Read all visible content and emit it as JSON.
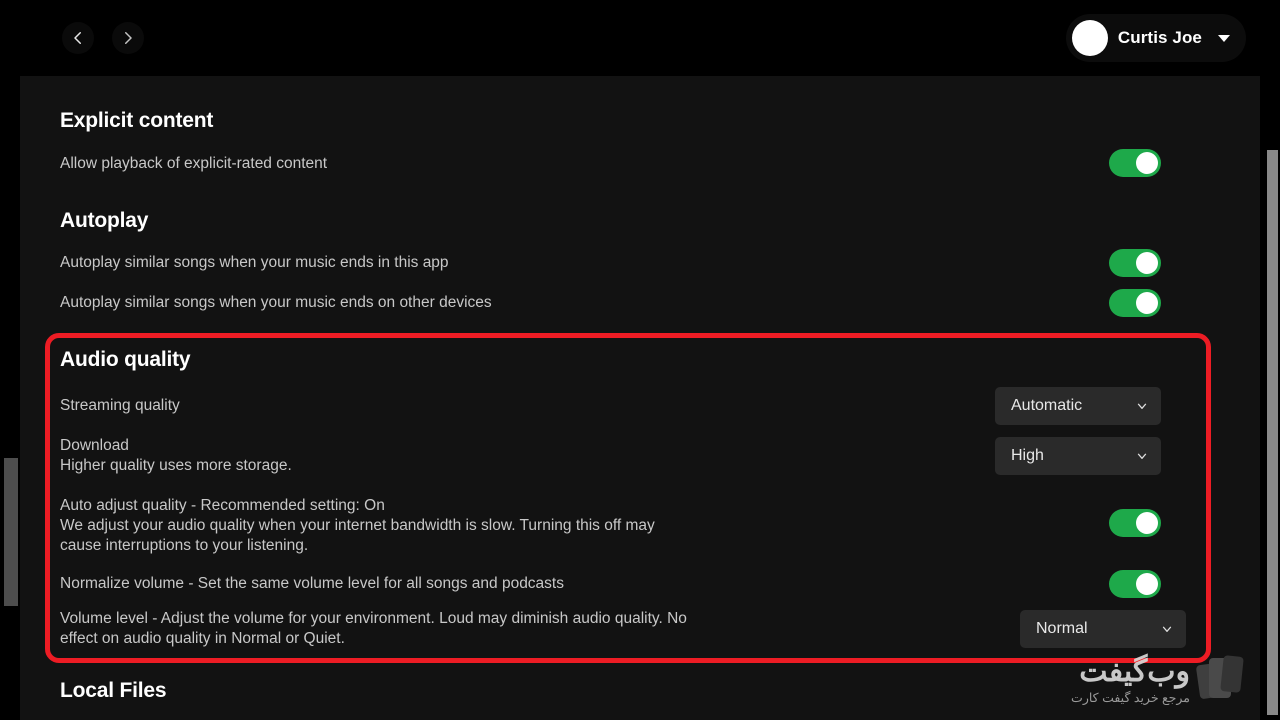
{
  "header": {
    "back_icon": "chevron-left-icon",
    "forward_icon": "chevron-right-icon",
    "user_name": "Curtis Joe",
    "user_caret_icon": "chevron-down-icon",
    "avatar_icon": "avatar"
  },
  "sections": {
    "explicit": {
      "title": "Explicit content",
      "row_label": "Allow playback of explicit-rated content",
      "toggle_state": "on"
    },
    "autoplay": {
      "title": "Autoplay",
      "row1_label": "Autoplay similar songs when your music ends in this app",
      "row1_toggle_state": "on",
      "row2_label": "Autoplay similar songs when your music ends on other devices",
      "row2_toggle_state": "on"
    },
    "audio_quality": {
      "title": "Audio quality",
      "streaming_label": "Streaming quality",
      "streaming_value": "Automatic",
      "download_label": "Download",
      "download_sub": "Higher quality uses more storage.",
      "download_value": "High",
      "auto_adjust_label": "Auto adjust quality - Recommended setting: On",
      "auto_adjust_sub_line1": "We adjust your audio quality when your internet bandwidth is slow. Turning this off may",
      "auto_adjust_sub_line2": "cause interruptions to your listening.",
      "auto_adjust_toggle_state": "on",
      "normalize_label": "Normalize volume - Set the same volume level for all songs and podcasts",
      "normalize_toggle_state": "on",
      "volume_level_line1": "Volume level - Adjust the volume for your environment. Loud may diminish audio quality. No",
      "volume_level_line2": "effect on audio quality in Normal or Quiet.",
      "volume_level_value": "Normal",
      "highlight_color": "#ed1c24"
    },
    "local_files": {
      "title": "Local Files"
    }
  },
  "watermark": {
    "main": "وب‌گیفت",
    "sub": "مرجع خرید گیفت کارت"
  },
  "colors": {
    "background": "#000000",
    "panel": "#121212",
    "toggle_on": "#1ea94a",
    "dropdown_bg": "#2a2a2a",
    "text_primary": "#ffffff",
    "text_secondary": "#c8c8c8",
    "highlight": "#ed1c24"
  }
}
